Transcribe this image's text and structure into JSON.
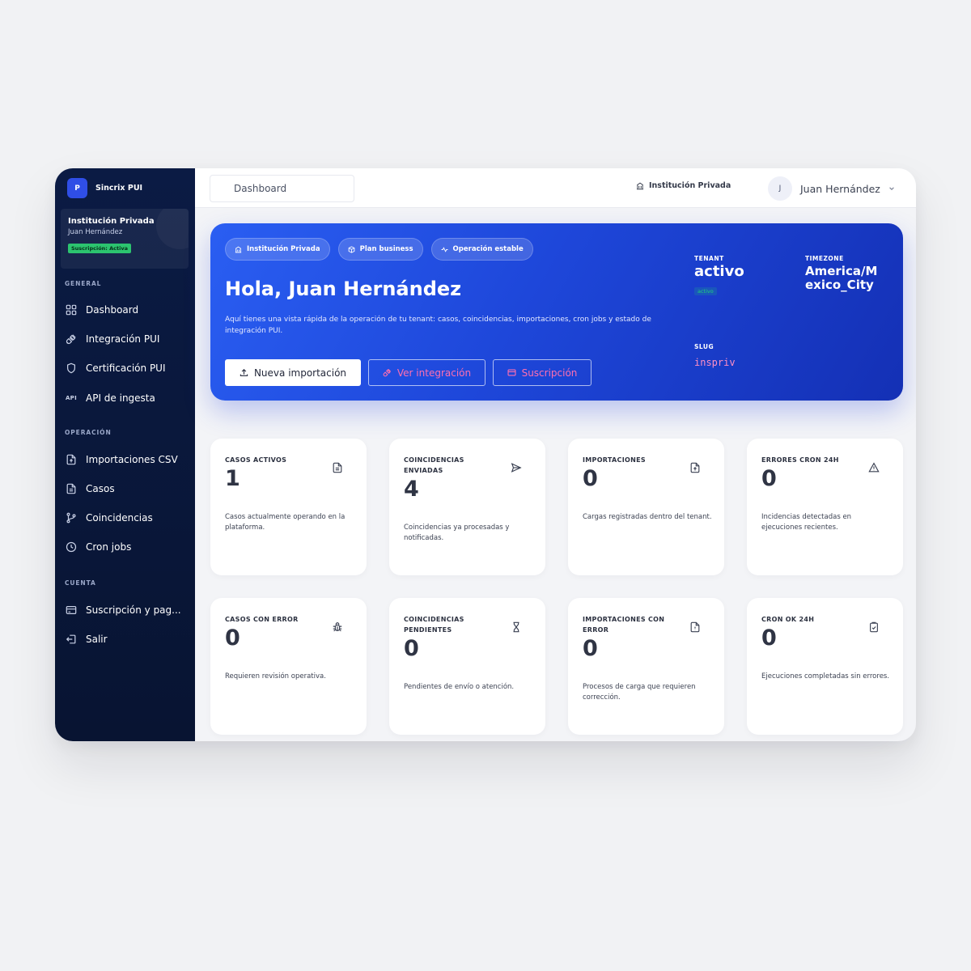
{
  "brand": {
    "logo_letter": "P",
    "name": "Sincrix PUI"
  },
  "tenant_card": {
    "name": "Institución Privada",
    "user": "Juan Hernández",
    "badge": "Suscripción: Activa"
  },
  "sidebar": {
    "sections": [
      {
        "title": "GENERAL",
        "items": [
          {
            "label": "Dashboard",
            "icon": "grid-icon"
          },
          {
            "label": "Integración PUI",
            "icon": "plug-icon"
          },
          {
            "label": "Certificación PUI",
            "icon": "shield-icon"
          },
          {
            "label": "API de ingesta",
            "icon": "api-icon",
            "icon_text": "API"
          }
        ]
      },
      {
        "title": "OPERACIÓN",
        "items": [
          {
            "label": "Importaciones CSV",
            "icon": "file-upload-icon"
          },
          {
            "label": "Casos",
            "icon": "file-text-icon"
          },
          {
            "label": "Coincidencias",
            "icon": "git-branch-icon"
          },
          {
            "label": "Cron jobs",
            "icon": "clock-icon"
          }
        ]
      },
      {
        "title": "CUENTA",
        "items": [
          {
            "label": "Suscripción y pag...",
            "icon": "credit-card-icon"
          },
          {
            "label": "Salir",
            "icon": "logout-icon"
          }
        ]
      }
    ]
  },
  "topbar": {
    "breadcrumb": "Dashboard",
    "institution": "Institución Privada",
    "avatar_letter": "J",
    "user_name": "Juan Hernández"
  },
  "hero": {
    "pills": [
      "Institución Privada",
      "Plan business",
      "Operación estable"
    ],
    "title": "Hola, Juan Hernández",
    "description": "Aquí tienes una vista rápida de la operación de tu tenant: casos, coincidencias, importaciones, cron jobs y estado de integración PUI.",
    "buttons": {
      "primary": "Nueva importación",
      "integration": "Ver integración",
      "subscription": "Suscripción"
    },
    "tenant": {
      "label": "TENANT",
      "value": "activo",
      "badge": "activo"
    },
    "timezone": {
      "label": "TIMEZONE",
      "value": "America/Mexico_City"
    },
    "slug": {
      "label": "SLUG",
      "value": "inspriv"
    }
  },
  "stats": [
    {
      "label": "CASOS ACTIVOS",
      "value": "1",
      "description": "Casos actualmente operando en la plataforma.",
      "icon": "file-icon"
    },
    {
      "label": "COINCIDENCIAS ENVIADAS",
      "value": "4",
      "description": "Coincidencias ya procesadas y notificadas.",
      "icon": "send-icon"
    },
    {
      "label": "IMPORTACIONES",
      "value": "0",
      "description": "Cargas registradas dentro del tenant.",
      "icon": "file-upload-icon"
    },
    {
      "label": "ERRORES CRON 24H",
      "value": "0",
      "description": "Incidencias detectadas en ejecuciones recientes.",
      "icon": "warning-icon"
    },
    {
      "label": "CASOS CON ERROR",
      "value": "0",
      "description": "Requieren revisión operativa.",
      "icon": "bug-icon"
    },
    {
      "label": "COINCIDENCIAS PENDIENTES",
      "value": "0",
      "description": "Pendientes de envío o atención.",
      "icon": "hourglass-icon"
    },
    {
      "label": "IMPORTACIONES CON ERROR",
      "value": "0",
      "description": "Procesos de carga que requieren corrección.",
      "icon": "file-alert-icon"
    },
    {
      "label": "CRON OK 24H",
      "value": "0",
      "description": "Ejecuciones completadas sin errores.",
      "icon": "clipboard-check-icon"
    }
  ]
}
